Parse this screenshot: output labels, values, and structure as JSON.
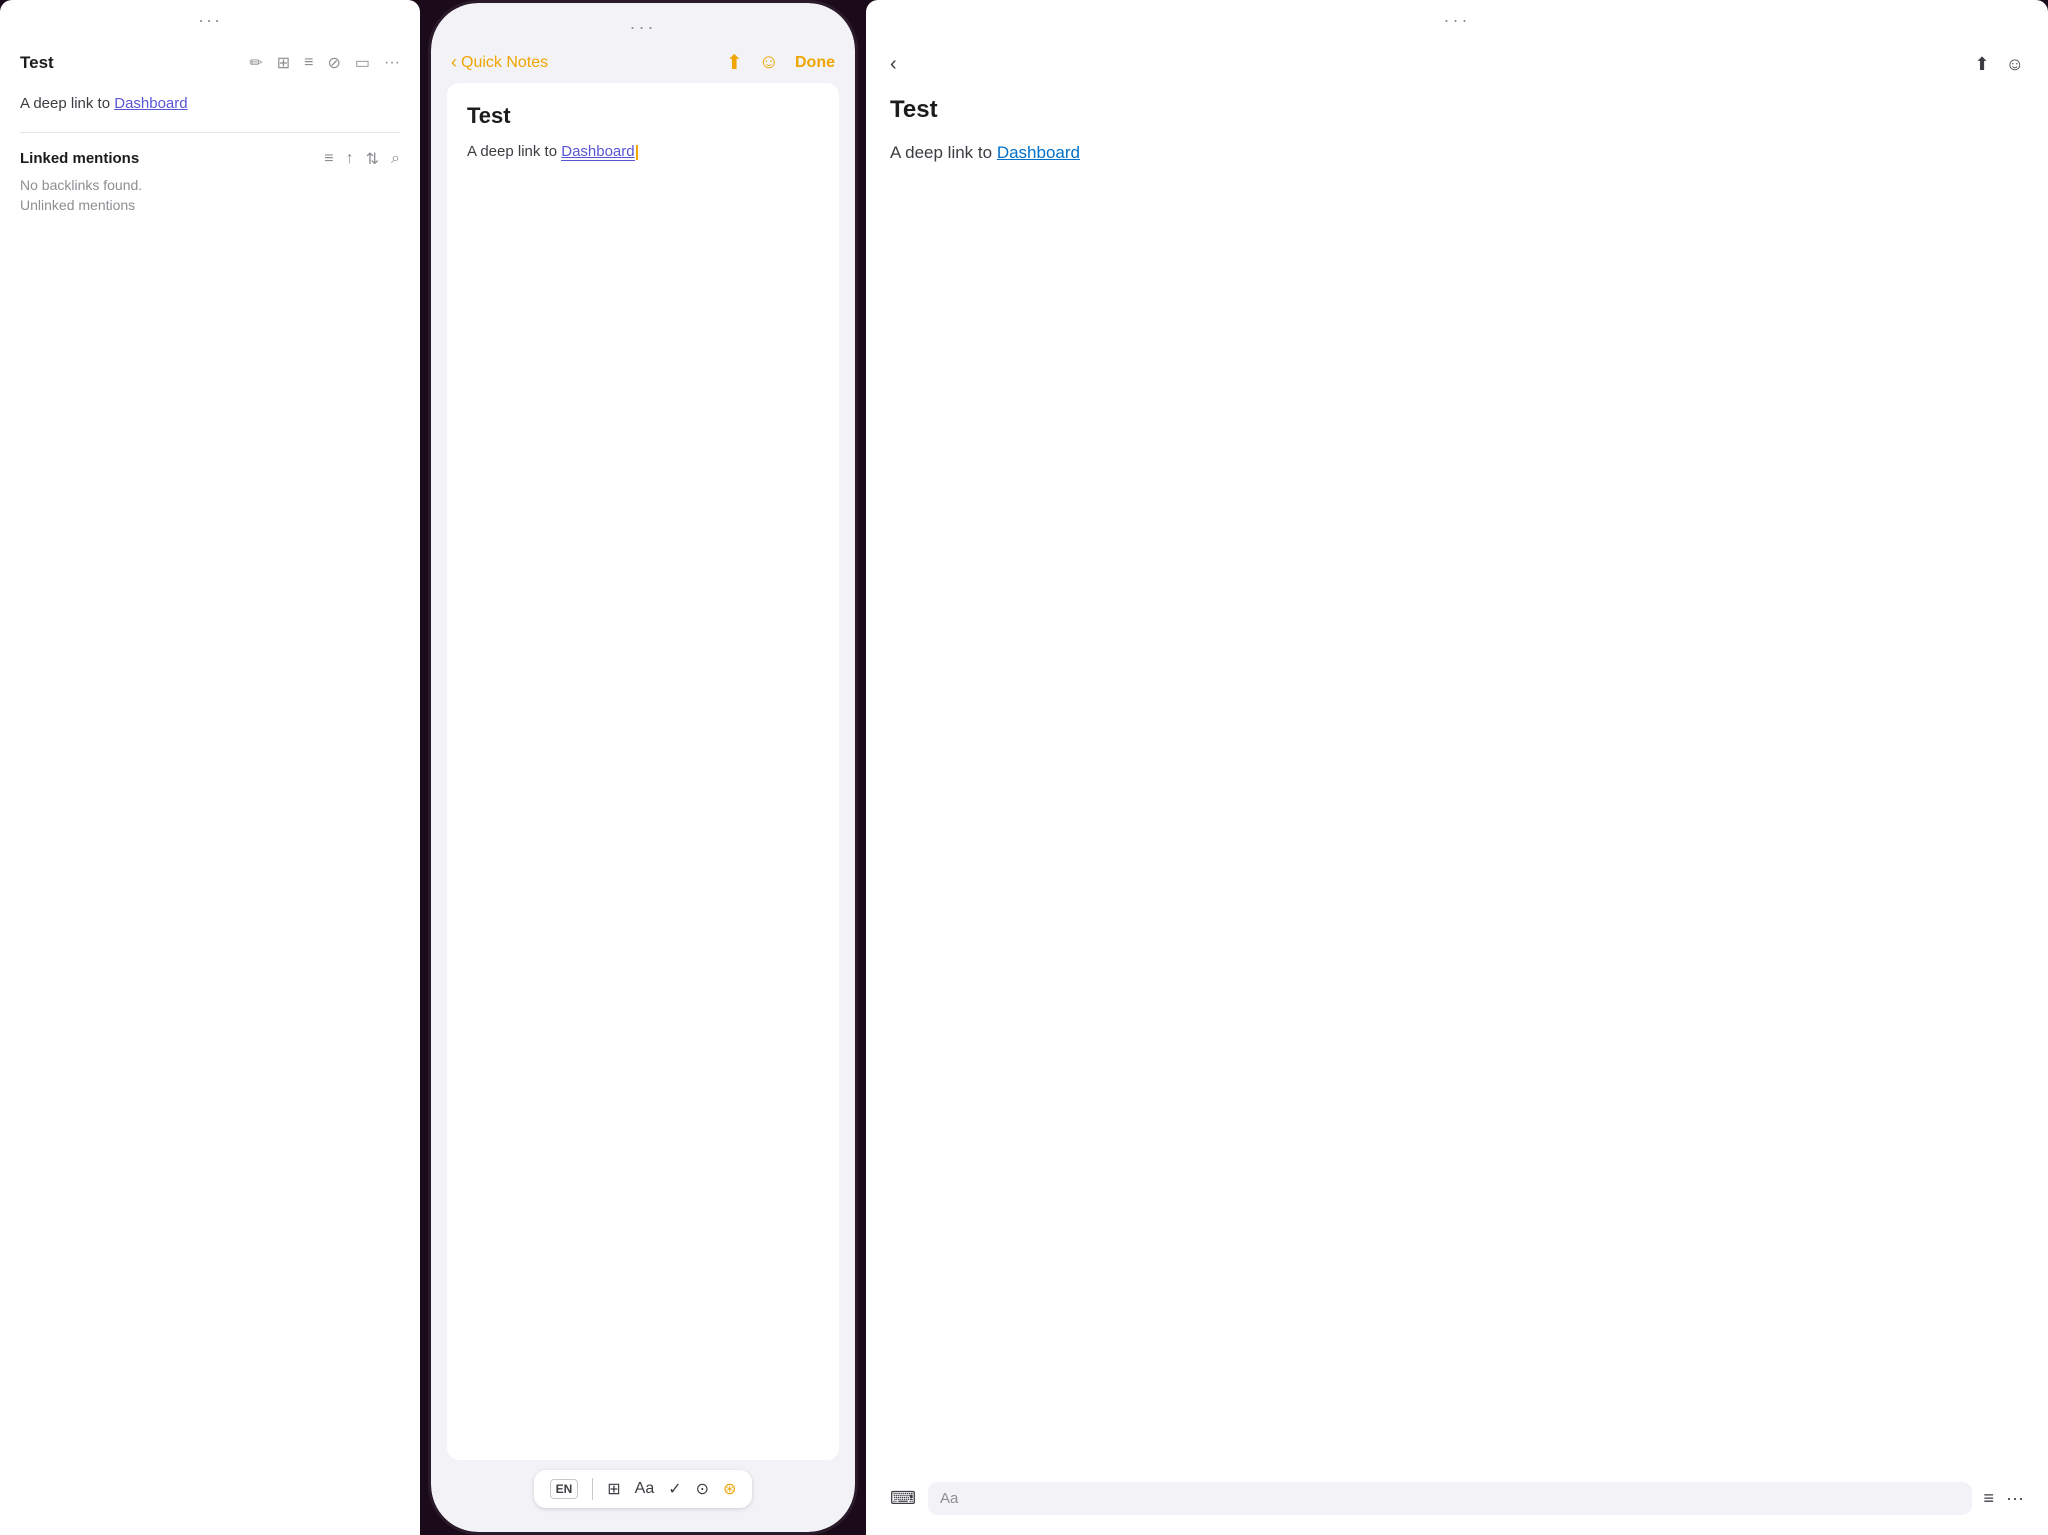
{
  "left_panel": {
    "three_dots": "···",
    "title": "Test",
    "icons": {
      "pencil": "✏",
      "grid": "⊞",
      "list": "≡",
      "bookmark": "⊘",
      "square": "▭",
      "ellipsis": "···"
    },
    "body_prefix": "A deep link to ",
    "body_link": "Dashboard",
    "linked_mentions": {
      "title": "Linked mentions",
      "icons": {
        "list": "≡",
        "arrow_up": "↑",
        "arrows_updown": "⇅",
        "search": "⌕"
      },
      "no_backlinks": "No backlinks found.",
      "unlinked": "Unlinked mentions"
    }
  },
  "middle_panel": {
    "three_dots": "···",
    "back_label": "Quick Notes",
    "nav_icons": {
      "share": "⬆",
      "smiley": "☺"
    },
    "done_label": "Done",
    "note_title": "Test",
    "body_prefix": "A deep link to ",
    "body_link": "Dashboard",
    "toolbar": {
      "keyboard_icon": "EN",
      "table_icon": "⊞",
      "aa_icon": "Aa",
      "list_icon": "✓",
      "camera_icon": "⊙",
      "squiggle_icon": "⊛"
    }
  },
  "right_panel": {
    "note_title": "Test",
    "body_prefix": "A deep link to ",
    "body_link": "Dashboard",
    "footer": {
      "aa_label": "Aa",
      "list_icon": "≡",
      "more_icon": "···"
    }
  }
}
